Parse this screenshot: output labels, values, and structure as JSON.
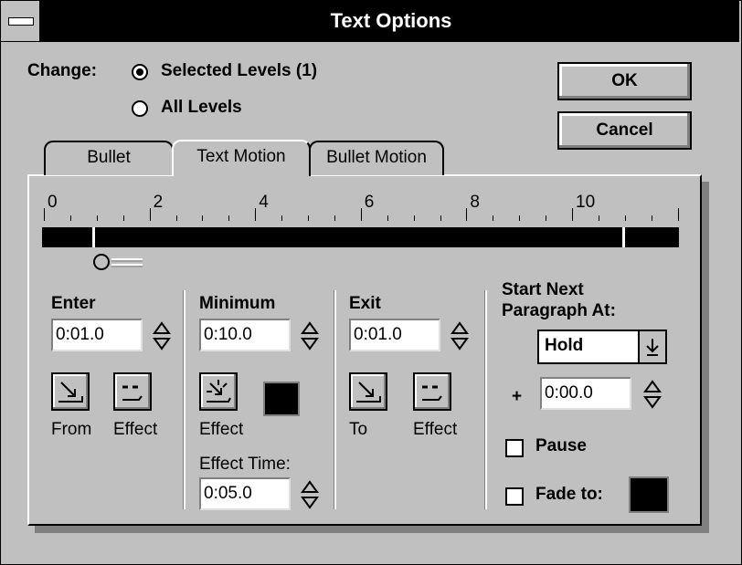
{
  "window": {
    "title": "Text Options"
  },
  "change": {
    "label": "Change:",
    "options": [
      {
        "label": "Selected Levels (1)",
        "selected": true
      },
      {
        "label": "All Levels",
        "selected": false
      }
    ]
  },
  "buttons": {
    "ok": "OK",
    "cancel": "Cancel"
  },
  "tabs": [
    {
      "label": "Bullet",
      "active": false
    },
    {
      "label": "Text Motion",
      "active": true
    },
    {
      "label": "Bullet Motion",
      "active": false
    }
  ],
  "timeline": {
    "ticks": [
      "0",
      "2",
      "4",
      "6",
      "8",
      "10"
    ]
  },
  "enter": {
    "label": "Enter",
    "value": "0:01.0",
    "from_label": "From",
    "effect_label": "Effect"
  },
  "minimum": {
    "label": "Minimum",
    "value": "0:10.0",
    "effect_label": "Effect",
    "effect_time_label": "Effect Time:",
    "effect_time_value": "0:05.0",
    "swatch_color": "#000000"
  },
  "exit": {
    "label": "Exit",
    "value": "0:01.0",
    "to_label": "To",
    "effect_label": "Effect"
  },
  "next_paragraph": {
    "label_line1": "Start Next",
    "label_line2": "Paragraph At:",
    "select_value": "Hold",
    "plus": "+",
    "offset_value": "0:00.0",
    "pause_label": "Pause",
    "pause_checked": false,
    "fade_label": "Fade to:",
    "fade_checked": false,
    "fade_color": "#000000"
  }
}
